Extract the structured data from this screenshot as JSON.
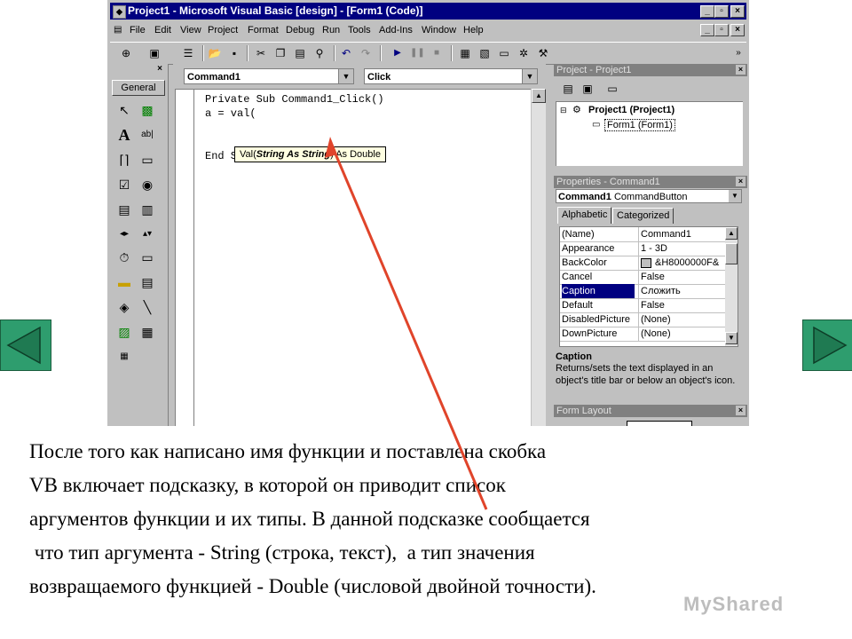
{
  "window": {
    "title": "Project1 - Microsoft Visual Basic [design] - [Form1 (Code)]",
    "controls": {
      "minimize": "_",
      "restore": "▫",
      "close": "×"
    }
  },
  "menu": {
    "items": [
      "File",
      "Edit",
      "View",
      "Project",
      "Format",
      "Debug",
      "Run",
      "Tools",
      "Add-Ins",
      "Window",
      "Help"
    ]
  },
  "toolbox": {
    "general_label": "General",
    "close": "×"
  },
  "code": {
    "object_combo": "Command1",
    "procedure_combo": "Click",
    "lines": [
      "Private Sub Command1_Click()",
      "a = val(",
      "End Sub"
    ],
    "tooltip": {
      "prefix": "Val(",
      "arg": "String As String",
      "suffix": ") As Double"
    }
  },
  "project_pane": {
    "title": "Project - Project1",
    "root": "Project1 (Project1)",
    "child": "Form1 (Form1)"
  },
  "properties_pane": {
    "title": "Properties - Command1",
    "object": "Command1",
    "object_type": "CommandButton",
    "tabs": [
      "Alphabetic",
      "Categorized"
    ],
    "rows": [
      {
        "name": "(Name)",
        "value": "Command1"
      },
      {
        "name": "Appearance",
        "value": "1 - 3D"
      },
      {
        "name": "BackColor",
        "value": "&H8000000F&"
      },
      {
        "name": "Cancel",
        "value": "False"
      },
      {
        "name": "Caption",
        "value": "Сложить"
      },
      {
        "name": "Default",
        "value": "False"
      },
      {
        "name": "DisabledPicture",
        "value": "(None)"
      },
      {
        "name": "DownPicture",
        "value": "(None)"
      }
    ],
    "desc_title": "Caption",
    "desc_text": "Returns/sets the text displayed in an object's title bar or below an object's icon."
  },
  "form_layout_pane": {
    "title": "Form Layout"
  },
  "caption": {
    "lines": [
      "После того как написано имя функции и поставлена скобка",
      "VB включает подсказку, в которой он приводит список",
      "аргументов функции и их типы. В данной подсказке сообщается",
      " что тип аргумента - String (строка, текст),  а тип значения",
      "возвращаемого функцией - Double (числовой двойной точности)."
    ]
  },
  "colors": {
    "titlebar": "#000080",
    "face": "#c0c0c0",
    "nav": "#2e9d6e",
    "arrow": "#e0442a"
  }
}
